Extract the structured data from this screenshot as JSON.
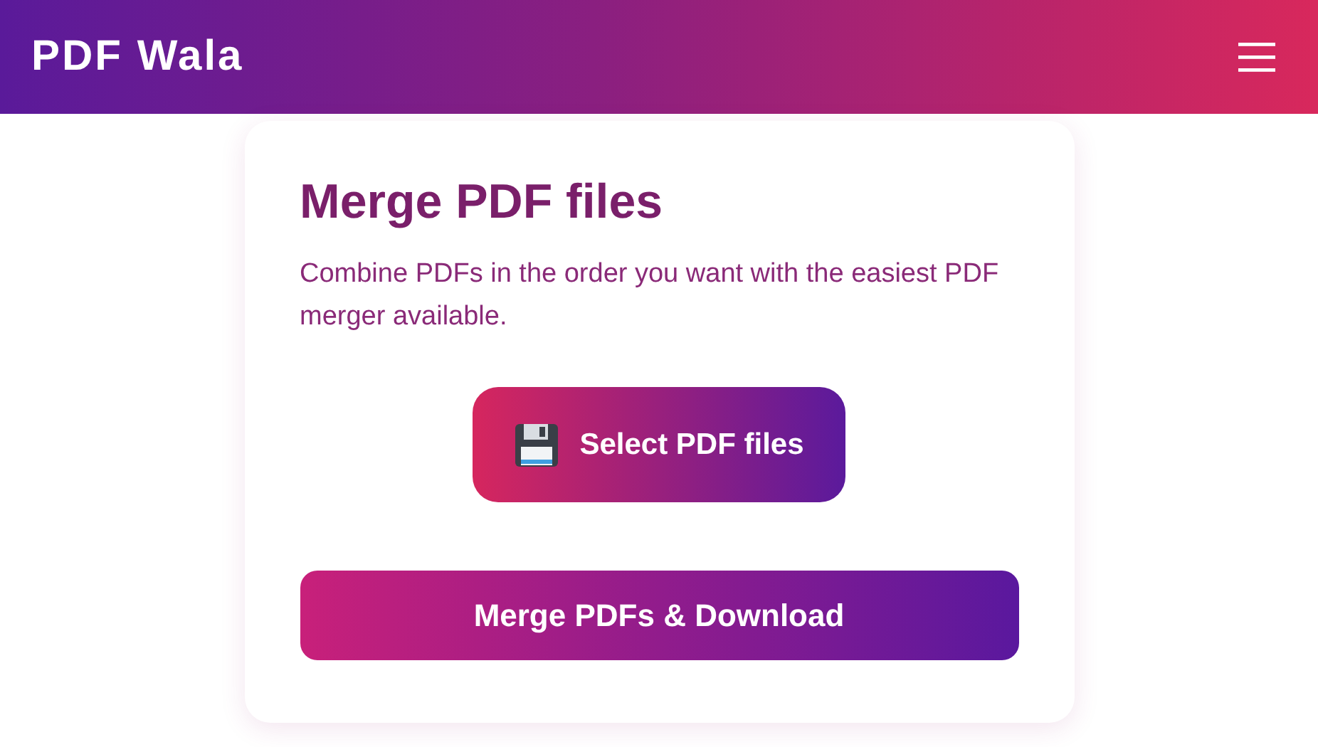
{
  "header": {
    "brand": "PDF Wala"
  },
  "card": {
    "title": "Merge PDF files",
    "description": "Combine PDFs in the order you want with the easiest PDF merger available.",
    "select_button": "Select PDF files",
    "merge_button": "Merge PDFs & Download"
  }
}
